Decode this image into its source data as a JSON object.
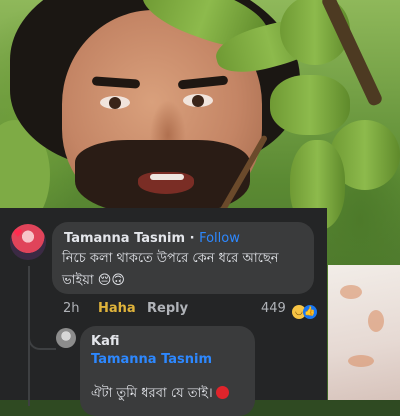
{
  "comment": {
    "author": "Tamanna Tasnim",
    "separator": " · ",
    "follow_label": "Follow",
    "text_line1": "নিচে কলা থাকতে উপরে কেন ধরে আছেন",
    "text_line2": "ভাইয়া",
    "text_emojis": "😔🙃",
    "time": "2h",
    "reaction_label": "Haha",
    "reply_label": "Reply",
    "reaction_count": "449",
    "reaction_icons": [
      "haha-emoji",
      "like-emoji"
    ]
  },
  "reply": {
    "author": "Kafi",
    "mention": "Tamanna Tasnim",
    "text": "ঐটা তুমি ধরবা যে তাই।"
  },
  "colors": {
    "panel_bg": "#242526",
    "bubble_bg": "#3a3b3c",
    "link": "#2d88ff",
    "haha": "#dfb33b"
  }
}
